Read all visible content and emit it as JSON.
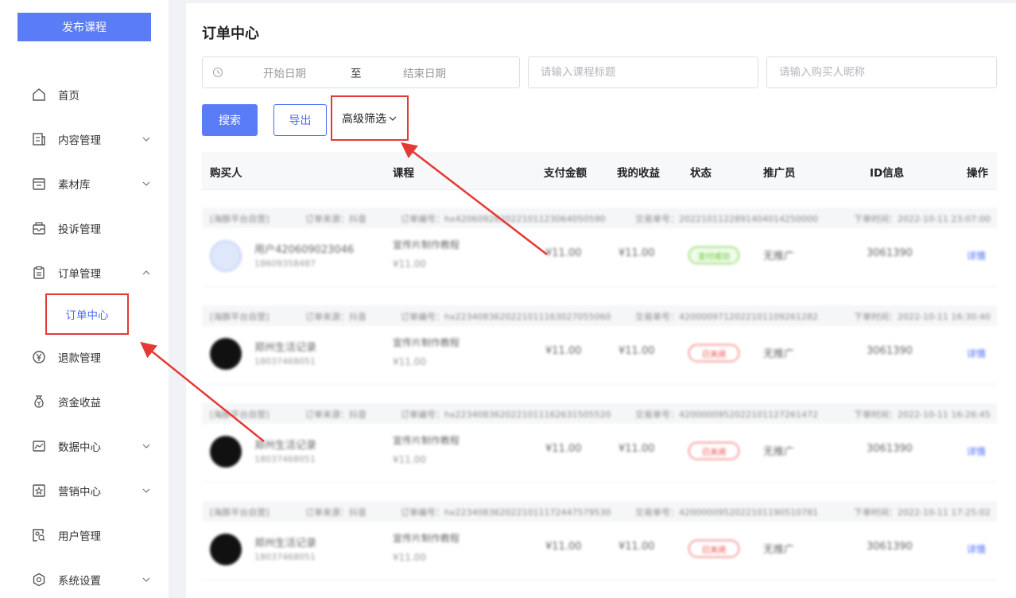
{
  "sidebar": {
    "publish_label": "发布课程",
    "items": [
      {
        "label": "首页",
        "icon": "home-icon",
        "has_chevron": false
      },
      {
        "label": "内容管理",
        "icon": "content-icon",
        "has_chevron": true
      },
      {
        "label": "素材库",
        "icon": "folder-icon",
        "has_chevron": true
      },
      {
        "label": "投诉管理",
        "icon": "complaint-icon",
        "has_chevron": false
      },
      {
        "label": "订单管理",
        "icon": "clipboard-icon",
        "has_chevron": true,
        "expanded": true
      },
      {
        "label": "退款管理",
        "icon": "yen-icon",
        "has_chevron": false
      },
      {
        "label": "资金收益",
        "icon": "money-bag-icon",
        "has_chevron": false
      },
      {
        "label": "数据中心",
        "icon": "chart-icon",
        "has_chevron": true
      },
      {
        "label": "营销中心",
        "icon": "star-icon",
        "has_chevron": true
      },
      {
        "label": "用户管理",
        "icon": "user-search-icon",
        "has_chevron": false
      },
      {
        "label": "系统设置",
        "icon": "settings-icon",
        "has_chevron": true
      }
    ],
    "active_sub_label": "订单中心"
  },
  "main": {
    "title": "订单中心",
    "date_start_placeholder": "开始日期",
    "date_sep": "至",
    "date_end_placeholder": "结束日期",
    "course_placeholder": "请输入课程标题",
    "buyer_placeholder": "请输入购买人昵称",
    "search_label": "搜索",
    "export_label": "导出",
    "advanced_filter_label": "高级筛选"
  },
  "table": {
    "headers": [
      "购买人",
      "课程",
      "支付金额",
      "我的收益",
      "状态",
      "推广员",
      "ID信息",
      "操作"
    ],
    "orders": [
      {
        "meta": [
          "[海豚平台自营]",
          "订单来源：抖音",
          "订单编号：hx420609282022101123064050590",
          "交易单号：2022101122891404014250000",
          "下单时间：2022-10-11 23:07:00"
        ],
        "buyer": "用户420609023046",
        "phone": "18609358487",
        "course": "宣传片制作教程",
        "price": "¥11.00",
        "pay": "¥11.00",
        "income": "¥11.00",
        "status": "支付成功",
        "status_kind": "ok",
        "promoter": "无推广",
        "id": "3061390",
        "action": "详情",
        "avatar": "light"
      },
      {
        "meta": [
          "[海豚平台自营]",
          "订单来源：抖音",
          "订单编号：hx2234083620221011163027055060",
          "交易单号：4200009712022101109261282",
          "下单时间：2022-10-11 16:30:40"
        ],
        "buyer": "郑州生活记录",
        "phone": "18037468051",
        "course": "宣传片制作教程",
        "price": "¥11.00",
        "pay": "¥11.00",
        "income": "¥11.00",
        "status": "已关闭",
        "status_kind": "bad",
        "promoter": "无推广",
        "id": "3061390",
        "action": "详情",
        "avatar": "dark"
      },
      {
        "meta": [
          "[海豚平台自营]",
          "订单来源：抖音",
          "订单编号：hx2234083620221011162631505520",
          "交易单号：4200000952022101127261472",
          "下单时间：2022-10-11 16:26:45"
        ],
        "buyer": "郑州生活记录",
        "phone": "18037468051",
        "course": "宣传片制作教程",
        "price": "¥11.00",
        "pay": "¥11.00",
        "income": "¥11.00",
        "status": "已关闭",
        "status_kind": "bad",
        "promoter": "无推广",
        "id": "3061390",
        "action": "详情",
        "avatar": "dark"
      },
      {
        "meta": [
          "[海豚平台自营]",
          "订单来源：抖音",
          "订单编号：hx2234083620221011172447579530",
          "交易单号：4200000952022101190510781",
          "下单时间：2022-10-11 17:25:02"
        ],
        "buyer": "郑州生活记录",
        "phone": "18037468051",
        "course": "宣传片制作教程",
        "price": "¥11.00",
        "pay": "¥11.00",
        "income": "¥11.00",
        "status": "已关闭",
        "status_kind": "bad",
        "promoter": "无推广",
        "id": "3061390",
        "action": "详情",
        "avatar": "dark"
      }
    ]
  },
  "colors": {
    "primary": "#5b7cf7",
    "active_text": "#4b6bf5",
    "highlight": "#e53935",
    "success": "#52c41a"
  }
}
